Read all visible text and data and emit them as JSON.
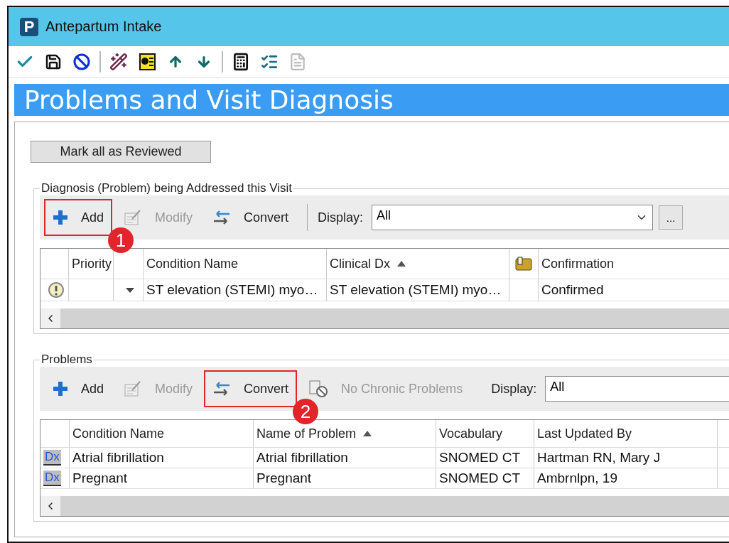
{
  "window": {
    "app_badge": "P",
    "title": "Antepartum Intake"
  },
  "toolbar": [
    {
      "kind": "check",
      "disabled": false
    },
    {
      "kind": "save",
      "disabled": false
    },
    {
      "kind": "cancel",
      "disabled": false
    },
    {
      "kind": "separator"
    },
    {
      "kind": "wand",
      "disabled": false
    },
    {
      "kind": "form",
      "disabled": false
    },
    {
      "kind": "up",
      "disabled": false
    },
    {
      "kind": "down",
      "disabled": false
    },
    {
      "kind": "separator"
    },
    {
      "kind": "calculator",
      "disabled": false
    },
    {
      "kind": "checklist",
      "disabled": false
    },
    {
      "kind": "document",
      "disabled": true
    }
  ],
  "header": "Problems and Visit Diagnosis",
  "review_button": "Mark all as Reviewed",
  "diagnosis": {
    "legend": "Diagnosis (Problem) being Addressed this Visit",
    "actions": [
      {
        "kind": "add",
        "label": "Add",
        "disabled": false,
        "callout": "1"
      },
      {
        "kind": "modify",
        "label": "Modify",
        "disabled": true
      },
      {
        "kind": "convert",
        "label": "Convert",
        "disabled": false
      }
    ],
    "display": {
      "label": "Display:",
      "value": "All"
    },
    "more_button": "...",
    "columns": [
      {
        "kind": "icon"
      },
      {
        "kind": "text",
        "label": "Priority"
      },
      {
        "kind": "blank"
      },
      {
        "kind": "text",
        "label": "Condition Name"
      },
      {
        "kind": "text",
        "label": "Clinical Dx",
        "sorted": true
      },
      {
        "kind": "folder"
      },
      {
        "kind": "text",
        "label": "Confirmation"
      }
    ],
    "rows": [
      {
        "kind": "alert",
        "condition_name": "ST elevation (STEMI) myo…",
        "clinical_dx": "ST elevation (STEMI) myo…",
        "confirmation": "Confirmed"
      }
    ]
  },
  "problems": {
    "legend": "Problems",
    "actions": [
      {
        "kind": "add",
        "label": "Add",
        "disabled": false
      },
      {
        "kind": "modify",
        "label": "Modify",
        "disabled": true
      },
      {
        "kind": "convert",
        "label": "Convert",
        "disabled": false,
        "callout": "2"
      },
      {
        "kind": "no-chronic",
        "label": "No Chronic Problems",
        "disabled": true
      }
    ],
    "display": {
      "label": "Display:",
      "value": "All"
    },
    "columns": [
      {
        "kind": "icon"
      },
      {
        "kind": "text",
        "label": "Condition Name"
      },
      {
        "kind": "text",
        "label": "Name of Problem",
        "sorted": true
      },
      {
        "kind": "text",
        "label": "Vocabulary"
      },
      {
        "kind": "text",
        "label": "Last Updated By"
      }
    ],
    "rows": [
      {
        "badge": "Dx",
        "condition_name": "Atrial fibrillation",
        "name_of_problem": "Atrial fibrillation",
        "vocabulary": "SNOMED CT",
        "last_updated_by": "Hartman RN, Mary J"
      },
      {
        "badge": "Dx",
        "condition_name": "Pregnant",
        "name_of_problem": "Pregnant",
        "vocabulary": "SNOMED CT",
        "last_updated_by": "Ambrnlpn, 19"
      }
    ]
  }
}
